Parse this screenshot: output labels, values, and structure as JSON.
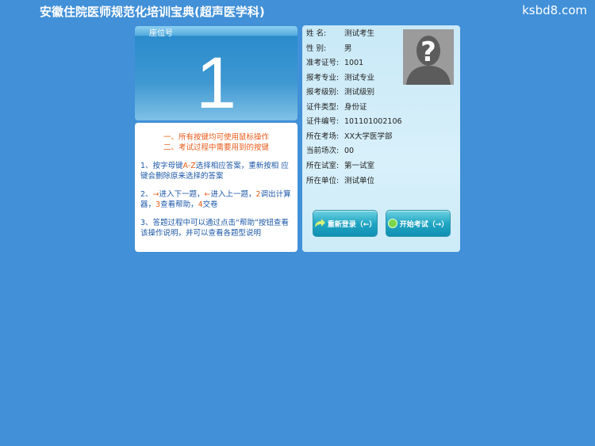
{
  "header": {
    "title": "安徽住院医师规范化培训宝典(超声医学科)",
    "site": "ksbd8.com"
  },
  "seat": {
    "label": "座位号",
    "number": "1"
  },
  "notice": {
    "head1": "一、所有按键均可使用鼠标操作",
    "head2": "二、考试过程中需要用到的按键",
    "item1_a": "1、按字母键",
    "item1_key": "A-Z",
    "item1_b": "选择相应答案，重新按相 应键会删除原来选择的答案",
    "item2_a": "2、",
    "item2_k1": "→",
    "item2_b": "进入下一题，",
    "item2_k2": "←",
    "item2_c": "进入上一题，",
    "item2_k3": "2",
    "item2_d": "调出计算器，",
    "item2_k4": "3",
    "item2_e": "查看帮助，",
    "item2_k5": "4",
    "item2_f": "交卷",
    "item3": "3、答题过程中可以通过点击“帮助”按钮查看该操作说明，并可以查看各题型说明"
  },
  "candidate": {
    "rows": [
      {
        "label": "姓 名:",
        "value": "测试考生"
      },
      {
        "label": "性 别:",
        "value": "男"
      },
      {
        "label": "准考证号:",
        "value": "1001"
      },
      {
        "label": "报考专业:",
        "value": "测试专业"
      },
      {
        "label": "报考级别:",
        "value": "测试级别"
      },
      {
        "label": "证件类型:",
        "value": "身份证"
      },
      {
        "label": "证件编号:",
        "value": "101101002106"
      },
      {
        "label": "所在考场:",
        "value": "XX大学医学部"
      },
      {
        "label": "当前场次:",
        "value": "00"
      },
      {
        "label": "所在试室:",
        "value": "第一试室"
      },
      {
        "label": "所在单位:",
        "value": "测试单位"
      }
    ]
  },
  "buttons": {
    "relogin": "重新登录（←）",
    "start": "开始考试（→）"
  },
  "icons": {
    "avatar": "unknown-person-icon",
    "relogin": "arrow-icon",
    "start": "green-dot-icon"
  },
  "colors": {
    "background": "#4190d8",
    "accent": "#e85b1a",
    "button": "#21a6c4"
  }
}
